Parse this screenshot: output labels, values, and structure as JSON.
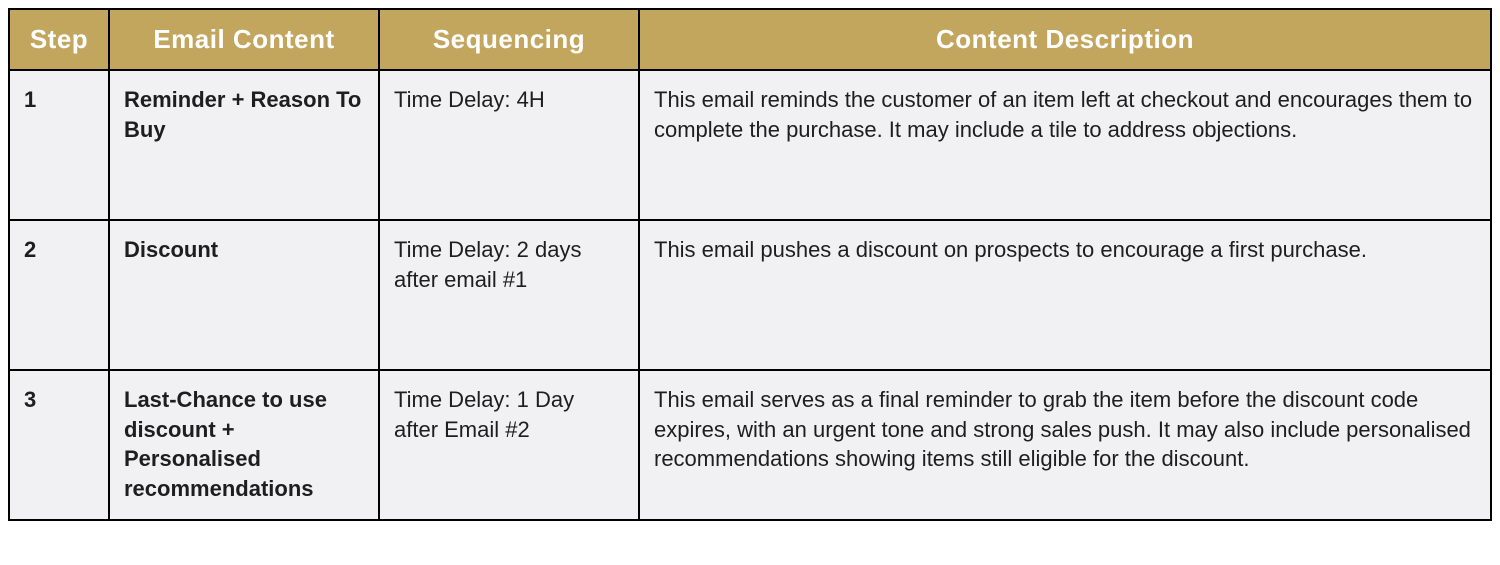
{
  "table": {
    "headers": {
      "step": "Step",
      "email_content": "Email Content",
      "sequencing": "Sequencing",
      "content_description": "Content Description"
    },
    "rows": [
      {
        "step": "1",
        "email_content": "Reminder + Reason To Buy",
        "sequencing": "Time Delay: 4H",
        "content_description": "This email reminds the customer of an item left at checkout and encourages them to complete the purchase. It may include a tile to address objections."
      },
      {
        "step": "2",
        "email_content": "Discount",
        "sequencing": "Time Delay: 2 days after email #1",
        "content_description": "This email pushes a discount on prospects to encourage a first purchase."
      },
      {
        "step": "3",
        "email_content": "Last-Chance to use discount + Personalised recommendations",
        "sequencing": "Time Delay: 1 Day after Email #2",
        "content_description": "This email serves as a final reminder to grab the item before the discount code expires, with an urgent tone and strong sales push. It may also include personalised recommendations showing items still eligible for the discount."
      }
    ]
  }
}
